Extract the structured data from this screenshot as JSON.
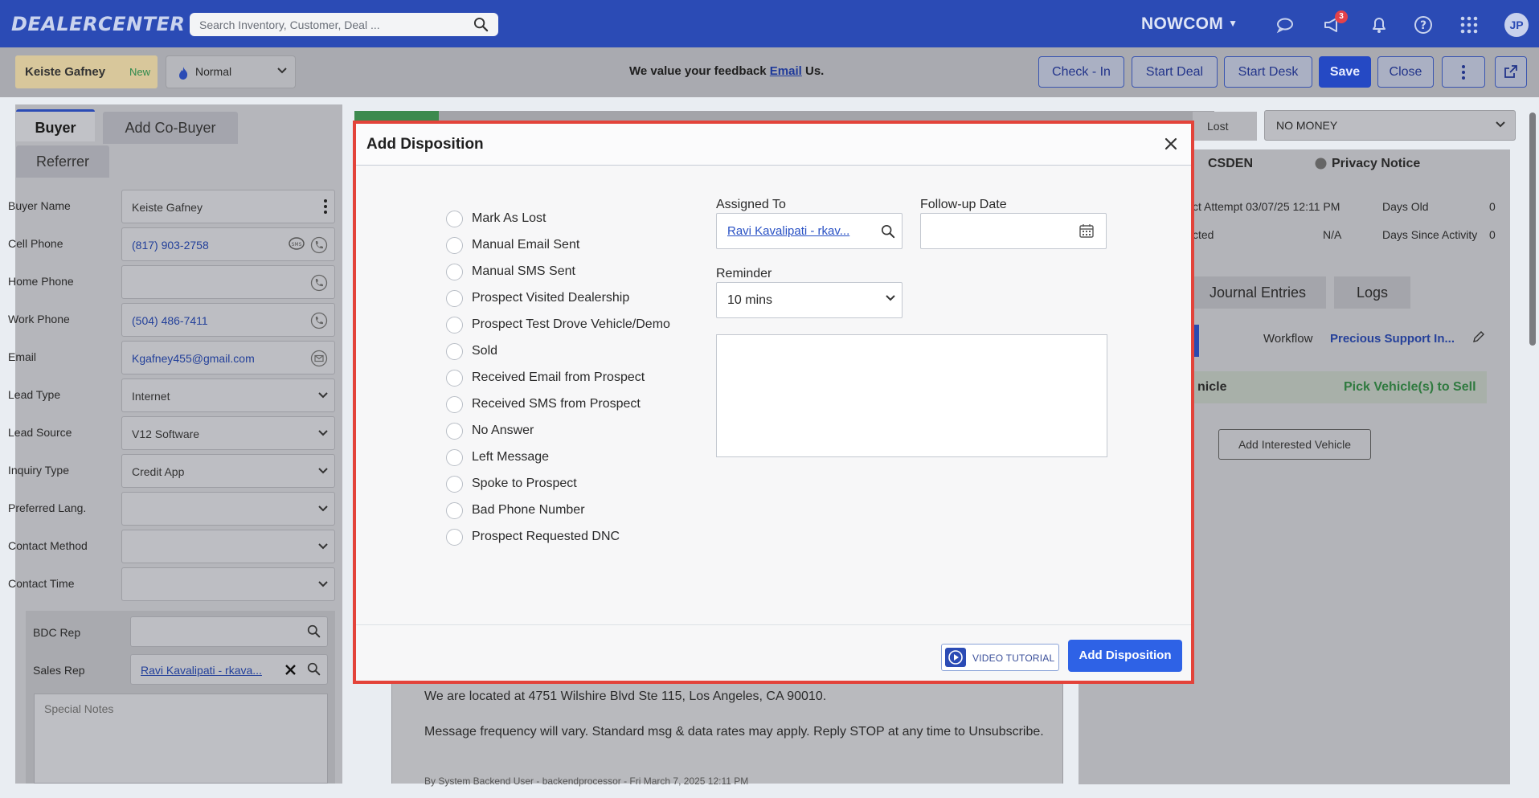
{
  "topbar": {
    "logo": "DEALERCENTER",
    "search_placeholder": "Search Inventory, Customer, Deal ...",
    "company": "NOWCOM",
    "notification_count": "3",
    "user_initials": "JP"
  },
  "header": {
    "customer_name": "Keiste Gafney",
    "customer_status": "New",
    "priority": "Normal",
    "feedback_prefix": "We value your feedback",
    "feedback_link": "Email",
    "feedback_suffix": "Us.",
    "buttons": {
      "check_in": "Check - In",
      "start_deal": "Start Deal",
      "start_desk": "Start Desk",
      "save": "Save",
      "close": "Close"
    }
  },
  "left": {
    "tabs": {
      "buyer": "Buyer",
      "add_co_buyer": "Add Co-Buyer",
      "referrer": "Referrer"
    },
    "fields": [
      {
        "label": "Buyer Name",
        "value": "Keiste Gafney"
      },
      {
        "label": "Cell Phone",
        "value": "(817) 903-2758"
      },
      {
        "label": "Home Phone",
        "value": ""
      },
      {
        "label": "Work Phone",
        "value": "(504) 486-7411"
      },
      {
        "label": "Email",
        "value": "Kgafney455@gmail.com"
      },
      {
        "label": "Lead Type",
        "value": "Internet"
      },
      {
        "label": "Lead Source",
        "value": "V12 Software"
      },
      {
        "label": "Inquiry Type",
        "value": "Credit App"
      },
      {
        "label": "Preferred Lang.",
        "value": ""
      },
      {
        "label": "Contact Method",
        "value": ""
      },
      {
        "label": "Contact Time",
        "value": ""
      }
    ],
    "bdc_rep_label": "BDC Rep",
    "sales_rep_label": "Sales Rep",
    "sales_rep_value": "Ravi Kavalipati - rkava...",
    "special_notes_placeholder": "Special Notes"
  },
  "right": {
    "lost_label": "Lost",
    "lost_reason": "NO MONEY",
    "csden": "CSDEN",
    "privacy_notice": "Privacy Notice",
    "last_attempt": "ct Attempt 03/07/25 12:11 PM",
    "days_old_label": "Days Old",
    "days_old_value": "0",
    "contacted_label": "cted",
    "contacted_value": "N/A",
    "days_since_activity_label": "Days Since Activity",
    "days_since_activity_value": "0",
    "tab_journal": "Journal Entries",
    "tab_logs": "Logs",
    "workflow_label": "Workflow",
    "workflow_value": "Precious Support In...",
    "vehicle_label": "nicle",
    "pick_vehicle": "Pick Vehicle(s) to Sell",
    "add_interested_vehicle": "Add Interested Vehicle"
  },
  "chat": {
    "line1": "We are located at 4751 Wilshire Blvd Ste 115, Los Angeles, CA 90010.",
    "line2": "Message frequency will vary. Standard msg & data rates may apply. Reply STOP at any time to Unsubscribe.",
    "line3": "By System Backend User - backendprocessor - Fri March 7, 2025 12:11 PM"
  },
  "modal": {
    "title": "Add Disposition",
    "options": [
      "Mark As Lost",
      "Manual Email Sent",
      "Manual SMS Sent",
      "Prospect Visited Dealership",
      "Prospect Test Drove Vehicle/Demo",
      "Sold",
      "Received Email from Prospect",
      "Received SMS from Prospect",
      "No Answer",
      "Left Message",
      "Spoke to Prospect",
      "Bad Phone Number",
      "Prospect Requested DNC"
    ],
    "assigned_to_label": "Assigned To",
    "assigned_to_value": "Ravi Kavalipati - rkav...",
    "follow_up_label": "Follow-up Date",
    "follow_up_value": "",
    "reminder_label": "Reminder",
    "reminder_value": "10 mins",
    "video_tutorial": "VIDEO TUTORIAL",
    "submit": "Add Disposition"
  },
  "colors": {
    "brand_blue": "#2b4bb5",
    "modal_highlight": "#e3433a",
    "primary_button": "#2e62e6"
  }
}
